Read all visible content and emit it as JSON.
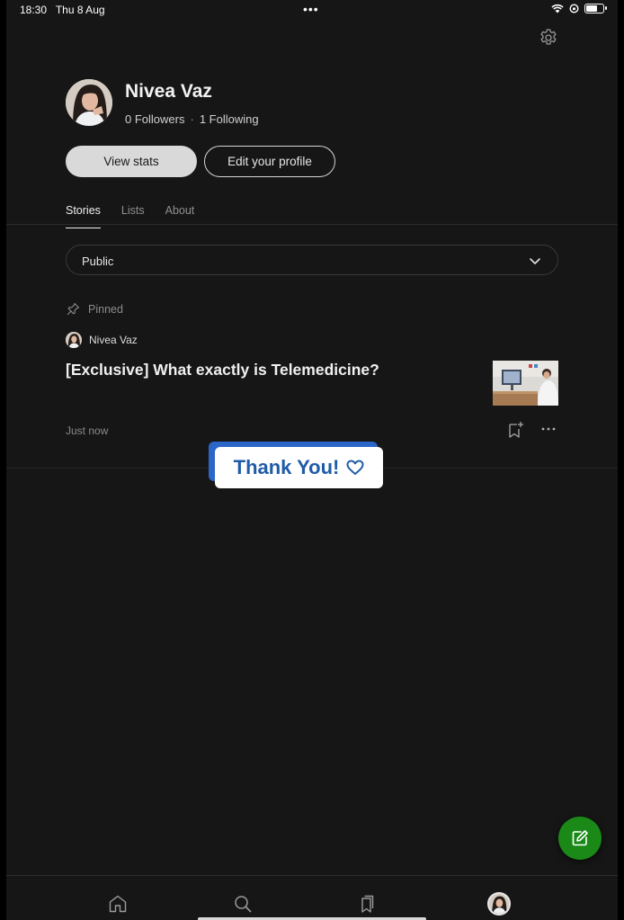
{
  "status_bar": {
    "time": "18:30",
    "date": "Thu 8 Aug",
    "dots": "•••",
    "battery_level": 0.6
  },
  "profile": {
    "name": "Nivea Vaz",
    "followers": "0 Followers",
    "separator": "·",
    "following": "1 Following",
    "view_stats_label": "View stats",
    "edit_profile_label": "Edit your profile"
  },
  "tabs": [
    {
      "label": "Stories",
      "active": true
    },
    {
      "label": "Lists",
      "active": false
    },
    {
      "label": "About",
      "active": false
    }
  ],
  "visibility_select": {
    "value": "Public"
  },
  "story": {
    "pinned_label": "Pinned",
    "author": "Nivea Vaz",
    "title": "[Exclusive] What exactly is Telemedicine?",
    "time": "Just now"
  },
  "sticker": {
    "text": "Thank You!"
  },
  "icons": {
    "settings": "gear-icon",
    "chevron": "chevron-down-icon",
    "pin": "pin-icon",
    "bookmark": "bookmark-add-icon",
    "more": "more-horizontal-icon",
    "fab": "write-icon",
    "nav": [
      "home-icon",
      "search-icon",
      "library-icon",
      "profile-avatar"
    ]
  },
  "colors": {
    "background": "#161616",
    "accent_green": "#1a8917",
    "sticker_blue": "#1f5ca8"
  }
}
